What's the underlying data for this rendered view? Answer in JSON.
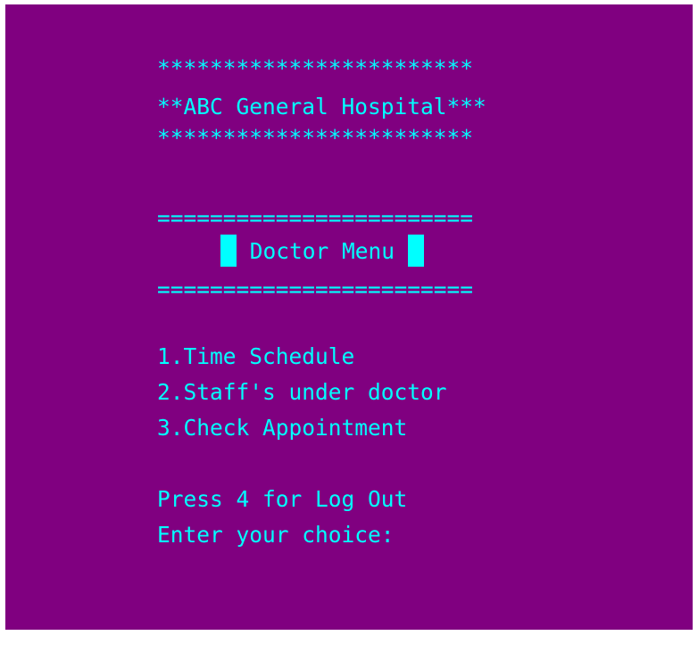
{
  "colors": {
    "background": "#800080",
    "text": "#00ffff"
  },
  "banner": {
    "top_border": "************************",
    "title": "**ABC General Hospital***",
    "bottom_border": "************************"
  },
  "menu_header": {
    "top_rule": "========================",
    "title": "Doctor Menu",
    "bottom_rule": "========================"
  },
  "options": [
    "1.Time Schedule",
    "2.Staff's under doctor",
    "3.Check Appointment"
  ],
  "logout_hint": "Press 4 for Log Out",
  "prompt": "Enter your choice:"
}
